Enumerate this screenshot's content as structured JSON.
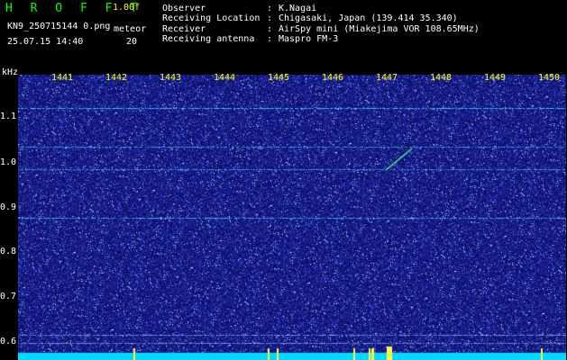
{
  "header": {
    "app_title": "H R O F F T",
    "version": "1.00f",
    "filename": "KN9_250715144 0.png",
    "datetime": "25.07.15 14:40",
    "meteor_label": "meteor",
    "meteor_count": "20",
    "info": [
      {
        "label": "Observer",
        "value": "K.Nagai"
      },
      {
        "label": "Receiving Location",
        "value": "Chigasaki, Japan (139.414 35.340)"
      },
      {
        "label": "Receiver",
        "value": "AirSpy mini (Miakejima VOR 108.65MHz)"
      },
      {
        "label": "Receiving antenna",
        "value": "Maspro FM-3"
      }
    ]
  },
  "spectrogram": {
    "y_unit": "kHz",
    "y_ticks": [
      "1.1",
      "1.0",
      "0.9",
      "0.8",
      "0.7",
      "0.6"
    ],
    "x_ticks": [
      "1441",
      "1442",
      "1443",
      "1444",
      "1445",
      "1446",
      "1447",
      "1448",
      "1449",
      "1450"
    ],
    "background_color": "#1a1aa0",
    "line_color": "#40c8ff",
    "baseline_color": "#00d8ff",
    "meteor_color": "#40ff80"
  }
}
